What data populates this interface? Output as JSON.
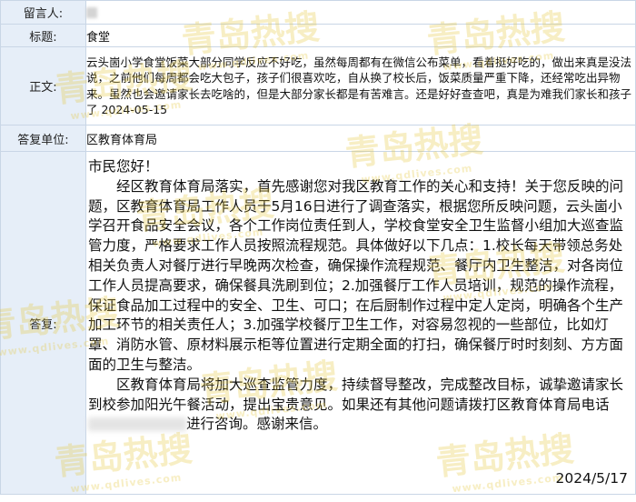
{
  "labels": {
    "name": "留言人:",
    "title": "标题:",
    "body": "正文:",
    "unit": "答复单位:",
    "reply": "答复:"
  },
  "message": {
    "title": "食堂",
    "body": "云头崮小学食堂饭菜大部分同学反应不好吃，虽然每周都有在微信公布菜单，看着挺好吃的，做出来真是没法说，之前他们每周都会吃大包子，孩子们很喜欢吃，自从换了校长后，饭菜质量严重下降，还经常吃出异物来。虽然也会邀请家长去吃啥的，但是大部分家长都是有苦难言。还是好好查查吧，真是为难我们家长和孩子了  2024-05-15"
  },
  "unit": "区教育体育局",
  "reply": {
    "greeting": "市民您好！",
    "paragraph1": "经区教育体育局落实，首先感谢您对我区教育工作的关心和支持！关于您反映的问题，区教育体育局工作人员于5月16日进行了调查落实，根据您所反映问题，云头崮小学召开食品安全会议，各个工作岗位责任到人，学校食堂安全卫生监督小组加大巡查监管力度，严格要求工作人员按照流程规范。具体做好以下几点：1.校长每天带领总务处相关负责人对餐厅进行早晚两次检查，确保操作流程规范、餐厅内卫生整洁，对各岗位工作人员提高要求，确保餐具洗刷到位；2.加强餐厅工作人员培训，规范的操作流程，保证食品加工过程中的安全、卫生、可口；在后厨制作过程中定人定岗，明确各个生产加工环节的相关责任人；3.加强学校餐厅卫生工作，对容易忽视的一些部位，比如灯罩、消防水管、原材料展示柜等位置进行定期全面的打扫，确保餐厅时时刻刻、方方面面的卫生与整洁。",
    "paragraph2_a": "区教育体育局将加大巡查监管力度，持续督导整改，完成整改目标，诚挚邀请家长到校参加阳光午餐活动，提出宝贵意见。如果还有其他问题请拨打区教育体育局电话",
    "paragraph2_b": "进行咨询。感谢来信。",
    "date": "2024/5/17"
  },
  "watermark": {
    "text": "青岛热搜",
    "url": "www.qdlives.com"
  }
}
